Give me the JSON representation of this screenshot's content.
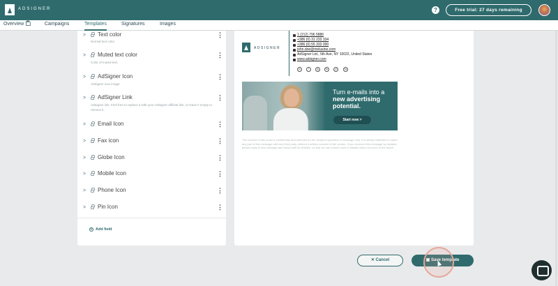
{
  "header": {
    "brand": "ADSIGNER",
    "help_icon": "?",
    "trial_label": "Free trial: 27 days remaining",
    "avatar_icon": "user-avatar"
  },
  "nav": {
    "items": [
      {
        "label": "Overview",
        "active": false
      },
      {
        "label": "Campaigns",
        "active": false
      },
      {
        "label": "Templates",
        "active": true
      },
      {
        "label": "Signatures",
        "active": false
      },
      {
        "label": "Images",
        "active": false
      }
    ]
  },
  "fields": [
    {
      "title": "Text color",
      "description": "Normal text color."
    },
    {
      "title": "Muted text color",
      "description": "Color of muted text."
    },
    {
      "title": "AdSigner Icon",
      "description": "AdSigner icon image."
    },
    {
      "title": "AdSigner Link",
      "description": "AdSigner link. Feel free to replace it with your AdSigner affiliate link, or leave it empty to remove it."
    },
    {
      "title": "Email Icon",
      "description": ""
    },
    {
      "title": "Fax icon",
      "description": ""
    },
    {
      "title": "Globe Icon",
      "description": ""
    },
    {
      "title": "Mobile Icon",
      "description": ""
    },
    {
      "title": "Phone Icon",
      "description": ""
    },
    {
      "title": "Pin Icon",
      "description": ""
    }
  ],
  "add_field_label": "Add field",
  "preview": {
    "brand": "ADSIGNER",
    "lines": [
      "1 (212) 796 5886",
      "+386 (0) 31 233 334",
      "+386 (0) 55 333 000",
      "john.doe@melusine.com",
      "AdSigner Ltd.,  5th Ave, NY 10022, United States",
      "www.adsigner.com"
    ],
    "social": [
      "in",
      "f",
      "ig",
      "tw",
      "yt",
      "sq"
    ],
    "banner": {
      "line1": "Turn e-mails into a",
      "line2": "new advertising",
      "line3": "potential.",
      "button": "Start now >"
    },
    "disclaimer": "The content of this email is confidential and intended for the recipient specified in message only. It is strictly forbidden to share any part of this message with any third party, without a written consent of the sender. If you received this message by mistake, please reply to this message and follow with its deletion, so that we can ensure such a mistake does not occur in the future."
  },
  "actions": {
    "cancel": "✕  Cancel",
    "save": "▣  Save template"
  },
  "colors": {
    "primary": "#2f6b6d",
    "background": "#e9eaeb"
  }
}
